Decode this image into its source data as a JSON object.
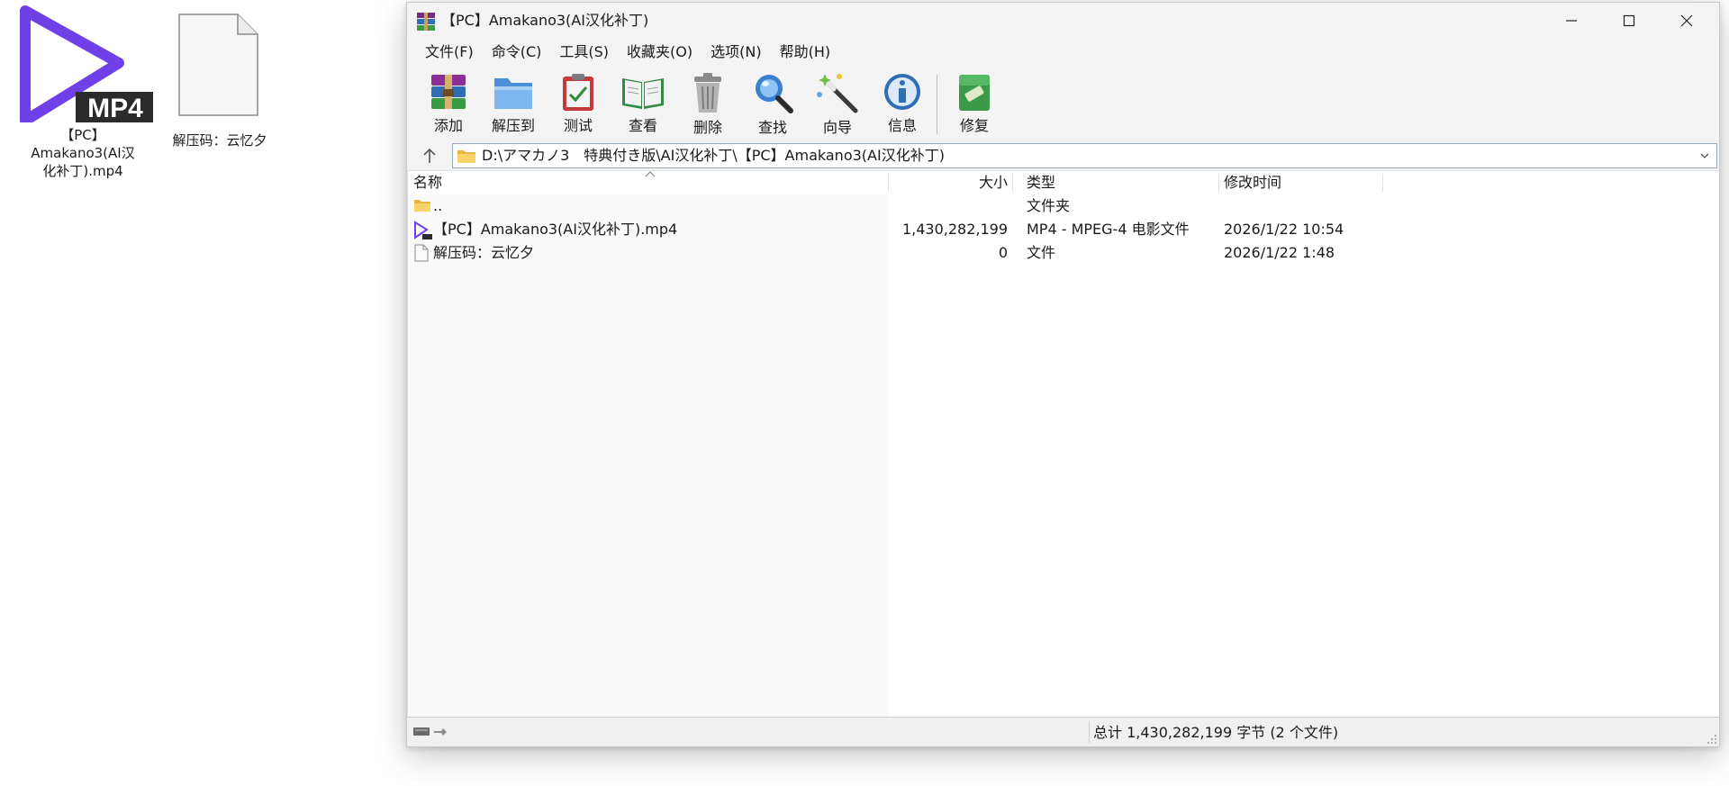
{
  "desktop": {
    "icons": [
      {
        "label_line1": "【PC】",
        "label_line2": "Amakano3(AI汉",
        "label_line3": "化补丁).mp4",
        "badge": "MP4",
        "icon": "mp4-video-icon"
      },
      {
        "label": "解压码：云忆夕",
        "icon": "blank-file-icon"
      }
    ]
  },
  "window": {
    "title": "【PC】Amakano3(AI汉化补丁)",
    "app_icon": "winrar-icon",
    "controls": {
      "minimize": "minimize-icon",
      "maximize": "maximize-icon",
      "close": "close-icon"
    }
  },
  "menu": [
    {
      "label": "文件(F)"
    },
    {
      "label": "命令(C)"
    },
    {
      "label": "工具(S)"
    },
    {
      "label": "收藏夹(O)"
    },
    {
      "label": "选项(N)"
    },
    {
      "label": "帮助(H)"
    }
  ],
  "toolbar": [
    {
      "label": "添加",
      "icon": "add-archive-icon"
    },
    {
      "label": "解压到",
      "icon": "extract-folder-icon"
    },
    {
      "label": "测试",
      "icon": "test-clipboard-icon"
    },
    {
      "label": "查看",
      "icon": "view-book-icon"
    },
    {
      "label": "删除",
      "icon": "delete-trash-icon"
    },
    {
      "label": "查找",
      "icon": "find-magnifier-icon"
    },
    {
      "label": "向导",
      "icon": "wizard-wand-icon"
    },
    {
      "label": "信息",
      "icon": "info-icon"
    },
    {
      "label": "修复",
      "icon": "repair-kit-icon"
    }
  ],
  "address": {
    "path": "D:\\アマカノ3　特典付き版\\AI汉化补丁\\【PC】Amakano3(AI汉化补丁)"
  },
  "columns": {
    "name": "名称",
    "size": "大小",
    "type": "类型",
    "modified": "修改时间"
  },
  "files": [
    {
      "name": "..",
      "size": "",
      "type": "文件夹",
      "modified": "",
      "icon": "folder-icon"
    },
    {
      "name": "【PC】Amakano3(AI汉化补丁).mp4",
      "size": "1,430,282,199",
      "type": "MP4 - MPEG-4 电影文件",
      "modified": "2026/1/22 10:54",
      "icon": "mp4-file-icon"
    },
    {
      "name": "解压码：云忆夕",
      "size": "0",
      "type": "文件",
      "modified": "2026/1/22 1:48",
      "icon": "blank-file-icon"
    }
  ],
  "status": {
    "summary": "总计 1,430,282,199 字节 (2 个文件)",
    "drive_icon": "drive-icon"
  },
  "colors": {
    "mp4_purple": "#6f3fe8",
    "title_bg": "#f3f3f3",
    "status_bg": "#f0f0f0"
  }
}
